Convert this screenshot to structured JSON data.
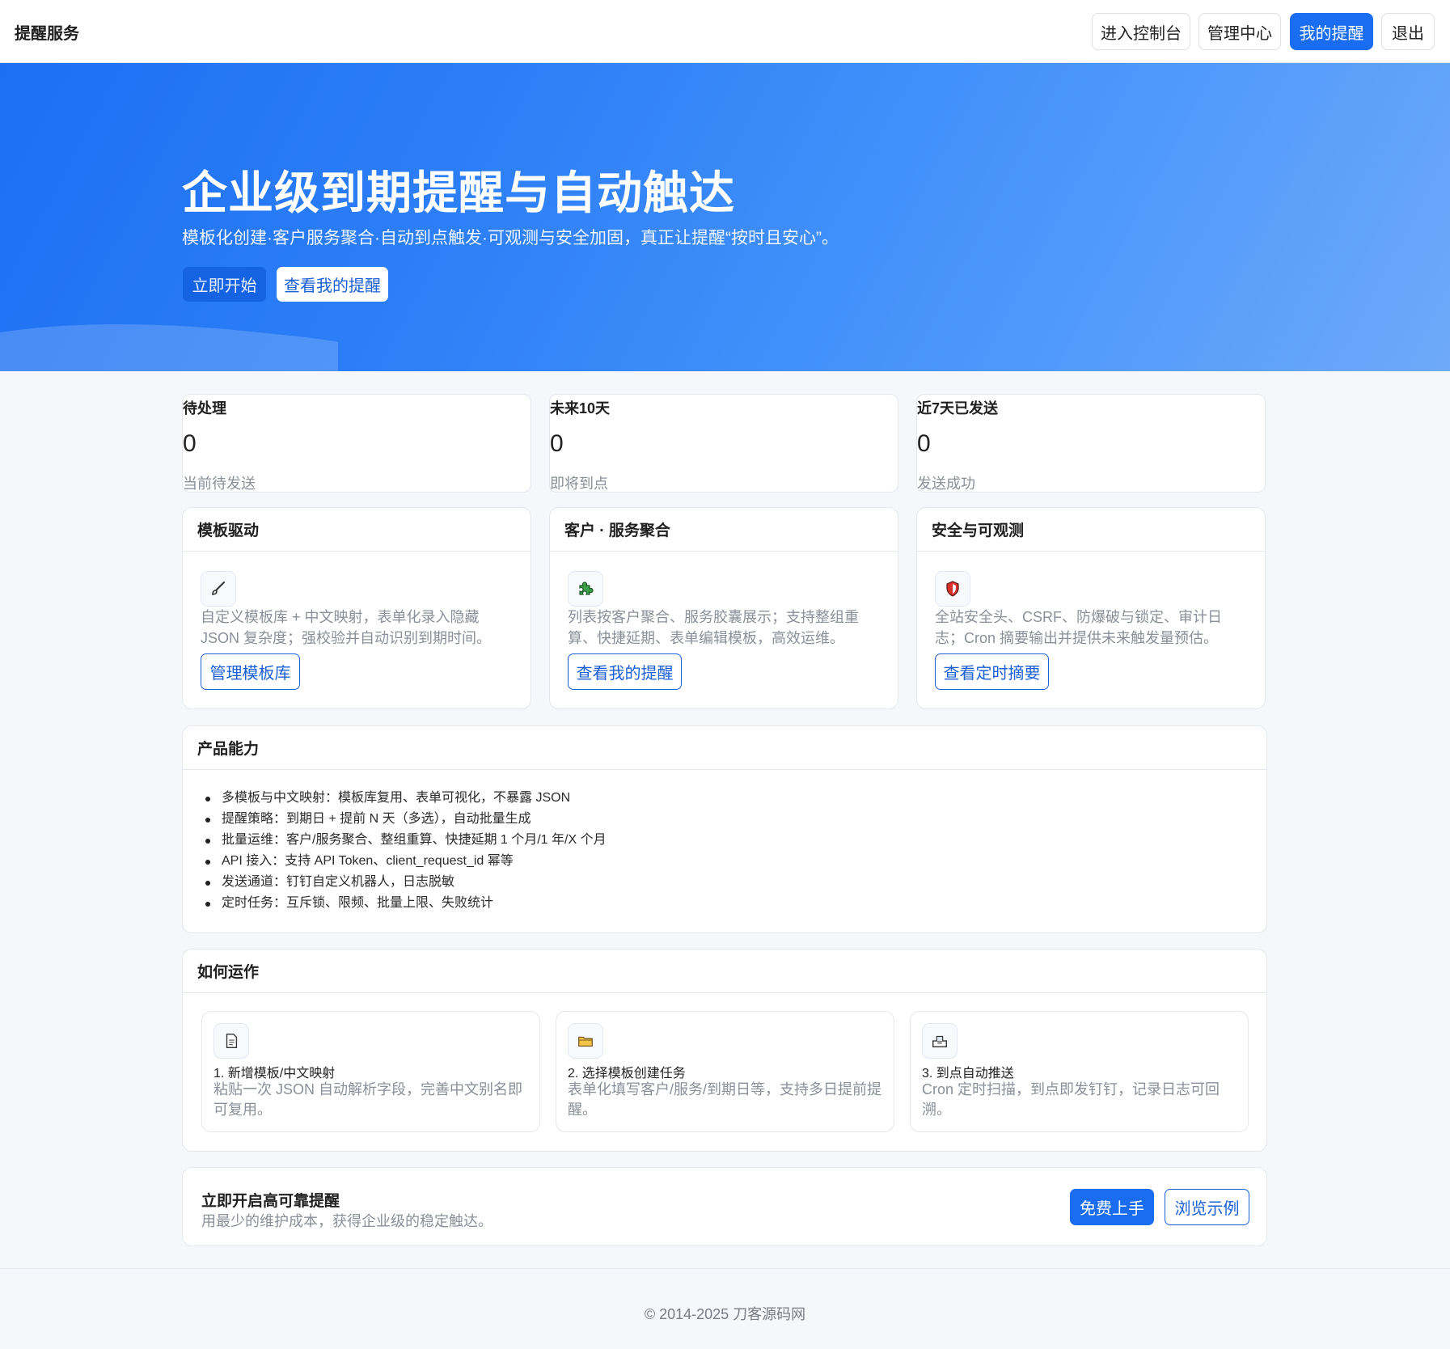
{
  "nav": {
    "brand": "提醒服务",
    "buttons": [
      "进入控制台",
      "管理中心",
      "我的提醒",
      "退出"
    ],
    "active_index": 2
  },
  "hero": {
    "title": "企业级到期提醒与自动触达",
    "subtitle": "模板化创建·客户服务聚合·自动到点触发·可观测与安全加固，真正让提醒“按时且安心”。",
    "start_button": "立即开始",
    "view_button": "查看我的提醒"
  },
  "stats": [
    {
      "label": "待处理",
      "value": "0",
      "desc": "当前待发送"
    },
    {
      "label": "未来10天",
      "value": "0",
      "desc": "即将到点"
    },
    {
      "label": "近7天已发送",
      "value": "0",
      "desc": "发送成功"
    }
  ],
  "features": [
    {
      "title": "模板驱动",
      "icon": "brush-icon",
      "text": "自定义模板库 + 中文映射，表单化录入隐藏 JSON 复杂度；强校验并自动识别到期时间。",
      "button": "管理模板库"
    },
    {
      "title": "客户 · 服务聚合",
      "icon": "puzzle-icon",
      "text": "列表按客户聚合、服务胶囊展示；支持整组重算、快捷延期、表单编辑模板，高效运维。",
      "button": "查看我的提醒"
    },
    {
      "title": "安全与可观测",
      "icon": "shield-icon",
      "text": "全站安全头、CSRF、防爆破与锁定、审计日志；Cron 摘要输出并提供未来触发量预估。",
      "button": "查看定时摘要"
    }
  ],
  "capabilities": {
    "title": "产品能力",
    "items": [
      "多模板与中文映射：模板库复用、表单可视化，不暴露 JSON",
      "提醒策略：到期日 + 提前 N 天（多选），自动批量生成",
      "批量运维：客户/服务聚合、整组重算、快捷延期 1 个月/1 年/X 个月",
      "API 接入：支持 API Token、client_request_id 幂等",
      "发送通道：钉钉自定义机器人，日志脱敏",
      "定时任务：互斥锁、限频、批量上限、失败统计"
    ]
  },
  "howto": {
    "title": "如何运作",
    "steps": [
      {
        "icon": "document-icon",
        "title": "1. 新增模板/中文映射",
        "desc": "粘贴一次 JSON 自动解析字段，完善中文别名即可复用。"
      },
      {
        "icon": "folder-icon",
        "title": "2. 选择模板创建任务",
        "desc": "表单化填写客户/服务/到期日等，支持多日提前提醒。"
      },
      {
        "icon": "outbox-icon",
        "title": "3. 到点自动推送",
        "desc": "Cron 定时扫描，到点即发钉钉，记录日志可回溯。"
      }
    ]
  },
  "cta": {
    "title": "立即开启高可靠提醒",
    "subtitle": "用最少的维护成本，获得企业级的稳定触达。",
    "primary_button": "免费上手",
    "secondary_button": "浏览示例"
  },
  "footer": {
    "text": "© 2014-2025 刀客源码网"
  },
  "colors": {
    "primary": "#1a6cf0",
    "hero_gradient_start": "#1c6ff3",
    "hero_gradient_end": "#6ea9fa",
    "muted_text": "#8a8f99"
  }
}
